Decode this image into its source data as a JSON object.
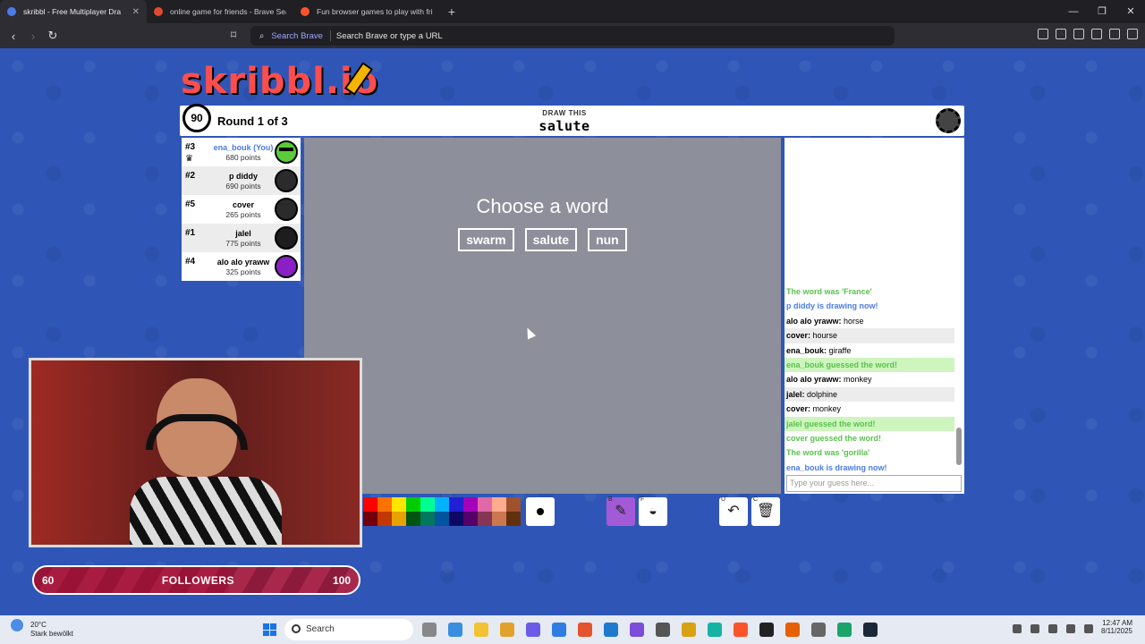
{
  "browser": {
    "tabs": [
      {
        "title": "skribbl - Free Multiplayer Dra",
        "active": true,
        "icon": "skribbl-favicon"
      },
      {
        "title": "online game for friends - Brave Sear",
        "active": false,
        "icon": "brave-search-favicon"
      },
      {
        "title": "Fun browser games to play with frie",
        "active": false,
        "icon": "brave-favicon"
      }
    ],
    "new_tab": "+",
    "search_engine_label": "Search Brave",
    "address_placeholder": "Search Brave or type a URL"
  },
  "game": {
    "logo": "skribbl.io",
    "timer": "90",
    "round": "Round 1 of 3",
    "draw_this_label": "DRAW THIS",
    "word": "salute",
    "players": [
      {
        "rank": "#3",
        "name": "ena_bouk (You)",
        "points": "680 points",
        "you": true,
        "drawing": true,
        "avatar_color": "#5ccb3a"
      },
      {
        "rank": "#2",
        "name": "p diddy",
        "points": "690 points",
        "you": false,
        "avatar_color": "#2b2b2b"
      },
      {
        "rank": "#5",
        "name": "cover",
        "points": "265 points",
        "you": false,
        "avatar_color": "#2b2b2b"
      },
      {
        "rank": "#1",
        "name": "jalel",
        "points": "775 points",
        "you": false,
        "avatar_color": "#1d1d1d"
      },
      {
        "rank": "#4",
        "name": "alo alo yraww",
        "points": "325 points",
        "you": false,
        "avatar_color": "#8a20c4"
      }
    ],
    "choose_prompt": "Choose a word",
    "choices": [
      "swarm",
      "salute",
      "nun"
    ],
    "chat": [
      {
        "text": "The word was 'France'",
        "style": "green"
      },
      {
        "text": "p diddy is drawing now!",
        "style": "blue"
      },
      {
        "author": "alo alo yraww:",
        "text": "horse",
        "style": "normal"
      },
      {
        "author": "cover:",
        "text": "hourse",
        "style": "normal"
      },
      {
        "author": "ena_bouk:",
        "text": "giraffe",
        "style": "normal"
      },
      {
        "text": "ena_bouk guessed the word!",
        "style": "greenbg"
      },
      {
        "author": "alo alo yraww:",
        "text": "monkey",
        "style": "normal"
      },
      {
        "author": "jalel:",
        "text": "dolphine",
        "style": "normal"
      },
      {
        "author": "cover:",
        "text": "monkey",
        "style": "normal"
      },
      {
        "text": "jalel guessed the word!",
        "style": "greenbg"
      },
      {
        "text": "cover guessed the word!",
        "style": "green"
      },
      {
        "text": "The word was 'gorilla'",
        "style": "green"
      },
      {
        "text": "ena_bouk is drawing now!",
        "style": "blue"
      }
    ],
    "chat_placeholder": "Type your guess here...",
    "palette_colors": [
      "#ff0000",
      "#ff7100",
      "#ffe400",
      "#00cc00",
      "#00ff91",
      "#00b2ff",
      "#231fd3",
      "#a300ba",
      "#df69a7",
      "#ffac8e",
      "#a0522d",
      "#73000f",
      "#c23800",
      "#e8a200",
      "#005510",
      "#00785d",
      "#00569e",
      "#0e0865",
      "#550069",
      "#873554",
      "#cc774d",
      "#63300d"
    ],
    "tools": [
      {
        "name": "pencil",
        "key": "B"
      },
      {
        "name": "fill",
        "key": "F"
      },
      {
        "name": "undo",
        "key": "U"
      },
      {
        "name": "clear",
        "key": "C"
      }
    ]
  },
  "overlay": {
    "followers_current": "60",
    "followers_label": "FOLLOWERS",
    "followers_goal": "100",
    "followers_progress": 0.6
  },
  "taskbar": {
    "temperature": "20°C",
    "condition": "Stark bewölkt",
    "search_label": "Search",
    "time": "12:47 AM",
    "date": "8/11/2025"
  }
}
